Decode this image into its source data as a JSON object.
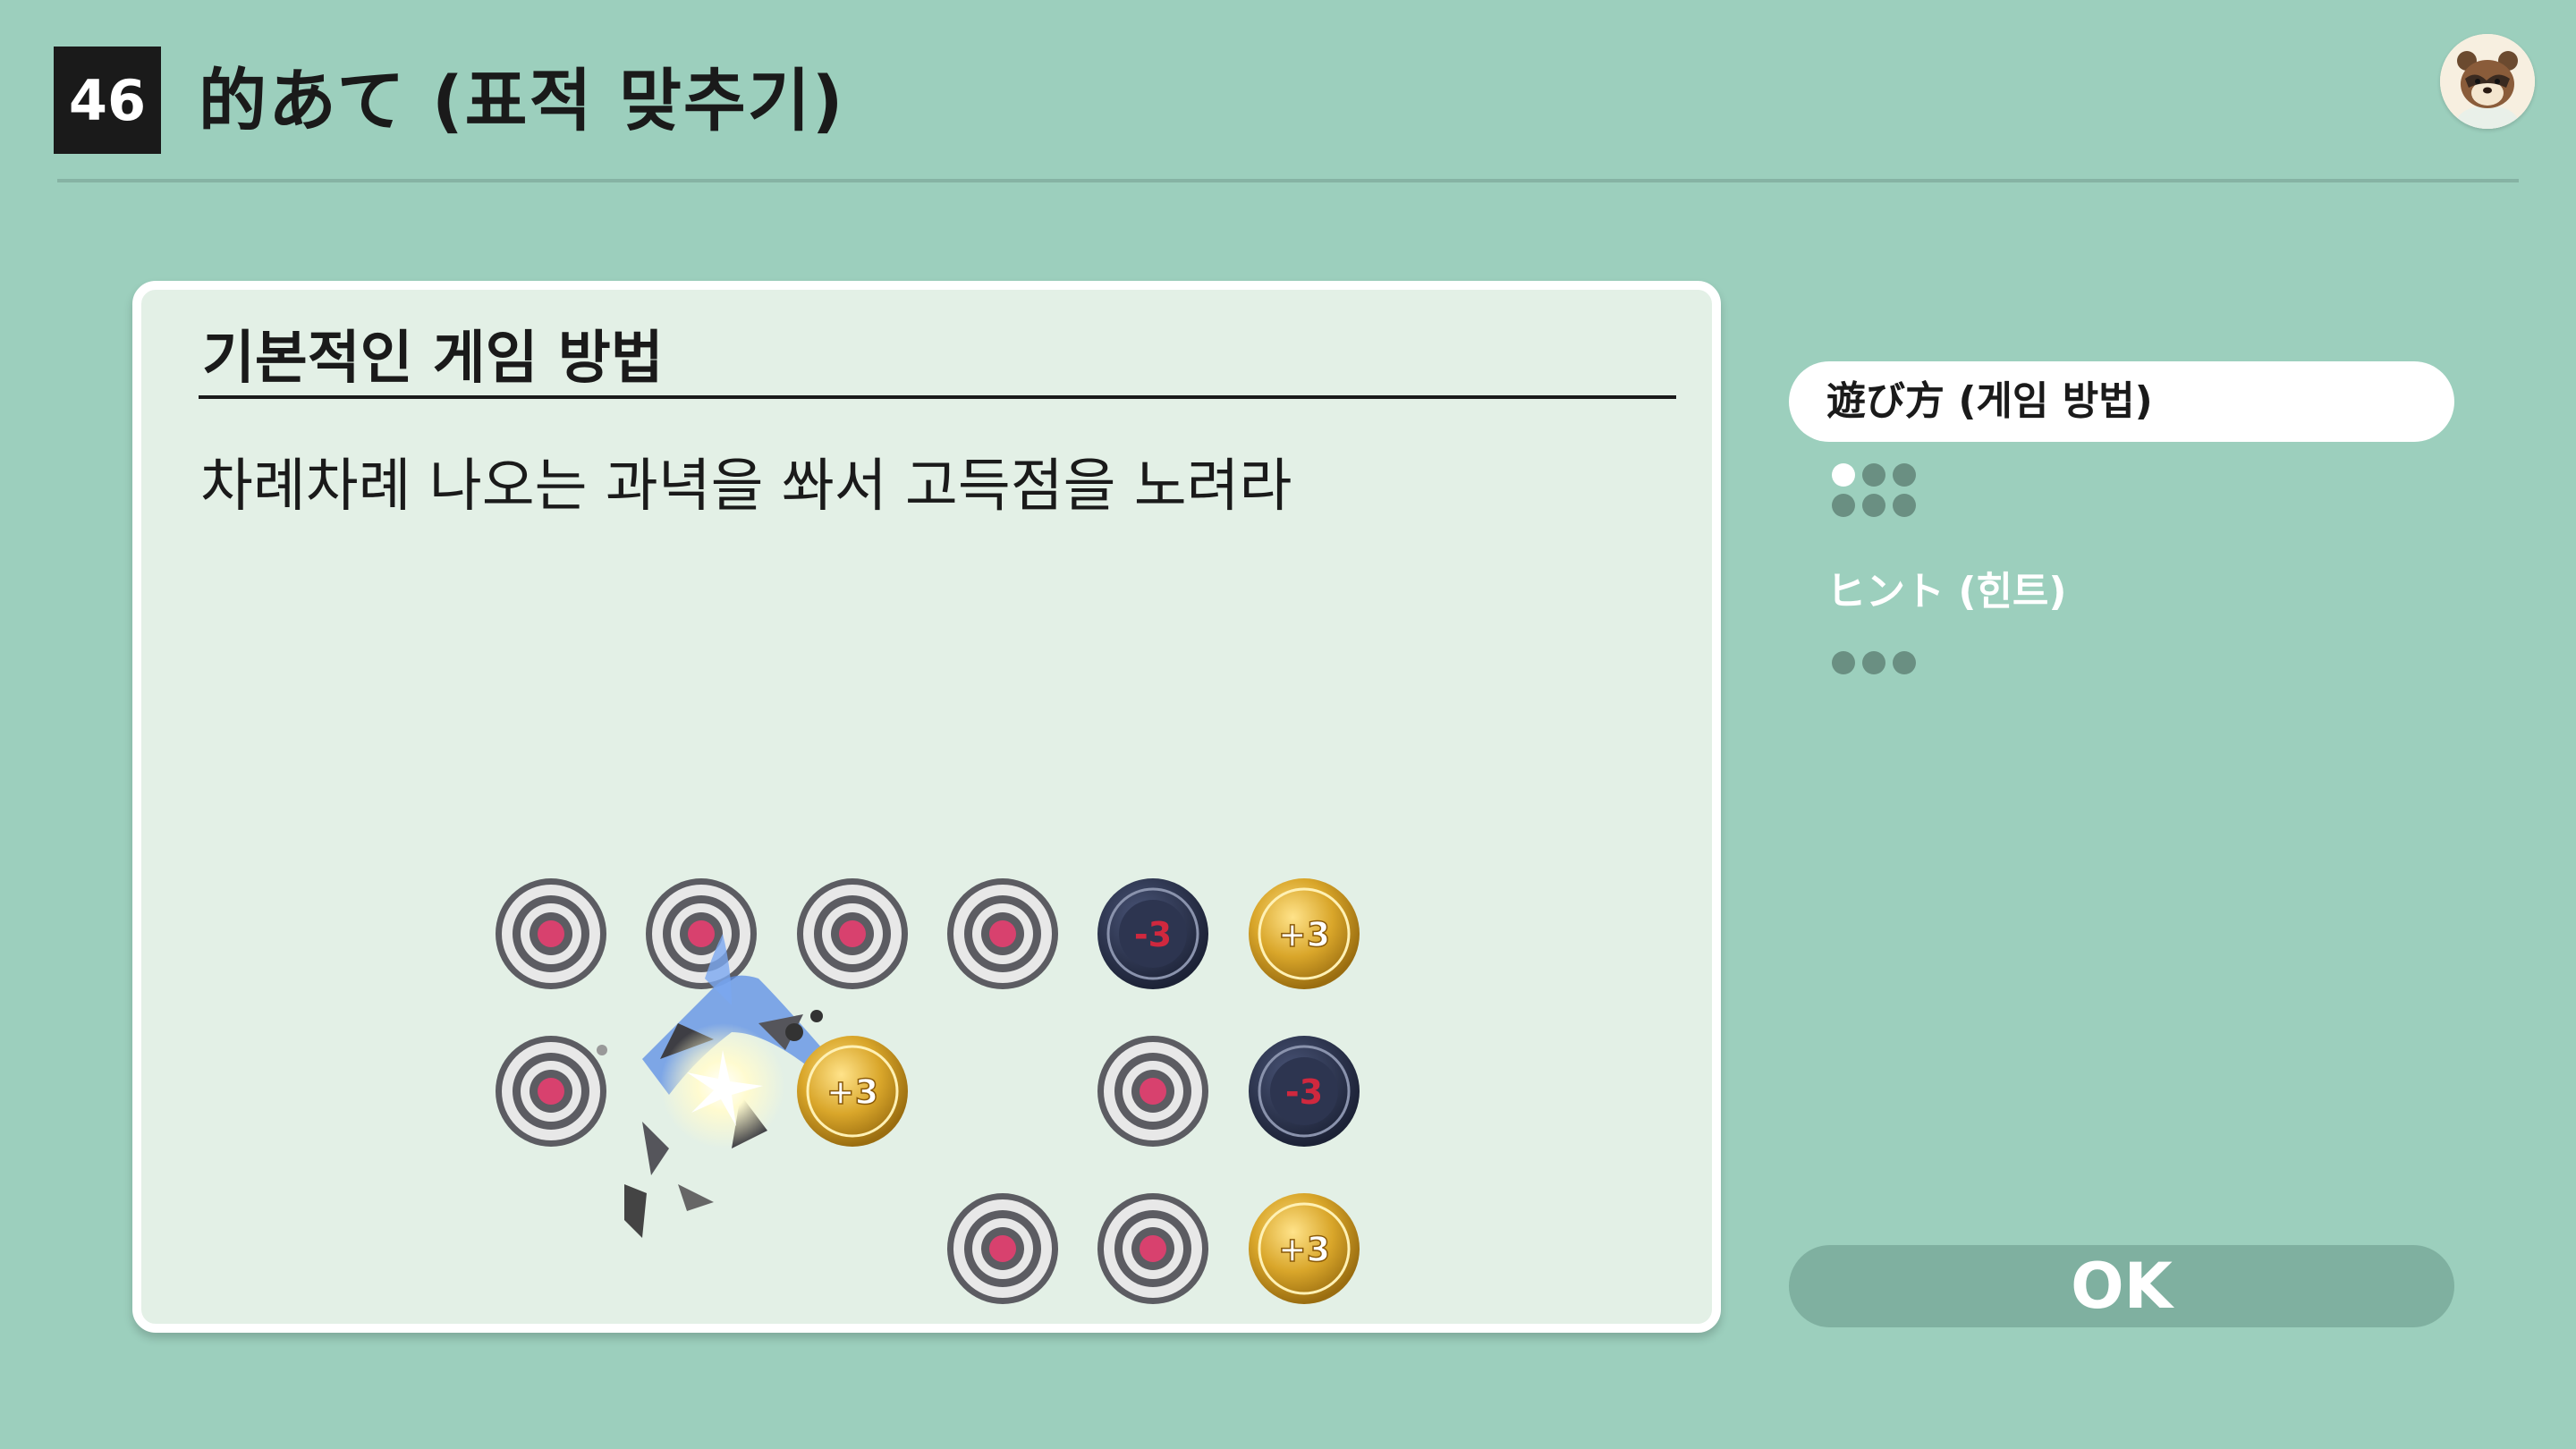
{
  "header": {
    "game_number": "46",
    "title": "的あて (표적 맞추기)"
  },
  "panel": {
    "heading": "기본적인 게임 방법",
    "description": "차례차례 나오는 과녁을 쏴서 고득점을 노려라",
    "targets": {
      "minus_label": "-3",
      "plus_label": "+3"
    }
  },
  "menu": {
    "items": [
      {
        "label": "遊び方 (게임 방법)",
        "active": true,
        "pages": 6,
        "current_page": 1
      },
      {
        "label": "ヒント (힌트)",
        "active": false,
        "pages": 3,
        "current_page": 0
      }
    ]
  },
  "ok_button": {
    "label": "OK"
  },
  "colors": {
    "background": "#9ccfbd",
    "panel": "#e3f0e6",
    "target_center": "#d8416e",
    "gold_target": "#d9a62a",
    "navy_target": "#2d3550"
  },
  "icons": {
    "avatar": "tom-nook-avatar",
    "menu_dots": "page-indicator-dots"
  }
}
